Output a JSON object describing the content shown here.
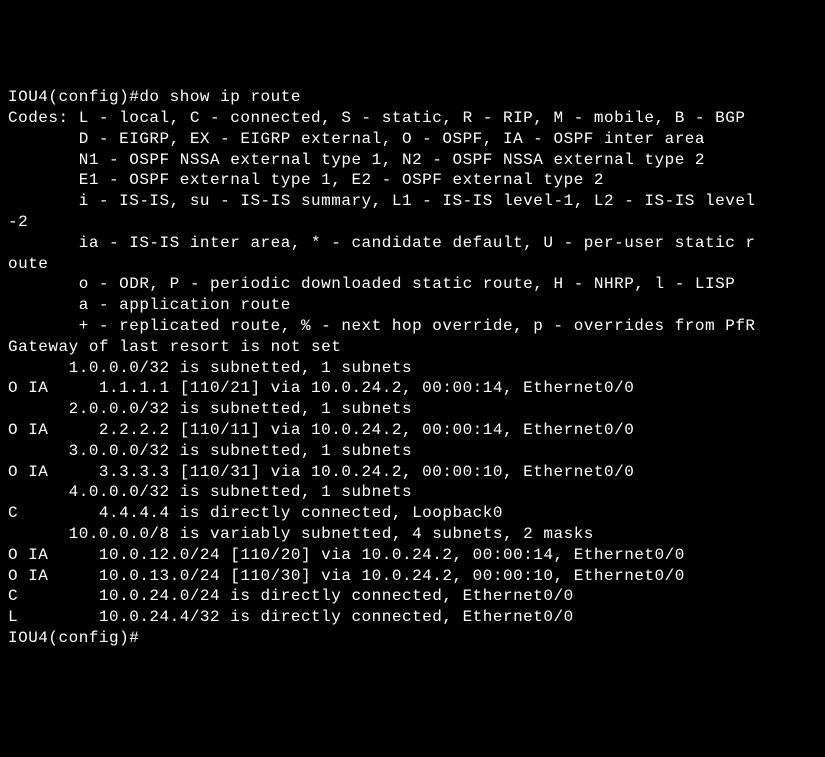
{
  "lines": [
    "IOU4(config)#do show ip route",
    "Codes: L - local, C - connected, S - static, R - RIP, M - mobile, B - BGP",
    "       D - EIGRP, EX - EIGRP external, O - OSPF, IA - OSPF inter area",
    "       N1 - OSPF NSSA external type 1, N2 - OSPF NSSA external type 2",
    "       E1 - OSPF external type 1, E2 - OSPF external type 2",
    "       i - IS-IS, su - IS-IS summary, L1 - IS-IS level-1, L2 - IS-IS level",
    "-2",
    "       ia - IS-IS inter area, * - candidate default, U - per-user static r",
    "oute",
    "       o - ODR, P - periodic downloaded static route, H - NHRP, l - LISP",
    "       a - application route",
    "       + - replicated route, % - next hop override, p - overrides from PfR",
    "",
    "Gateway of last resort is not set",
    "",
    "      1.0.0.0/32 is subnetted, 1 subnets",
    "O IA     1.1.1.1 [110/21] via 10.0.24.2, 00:00:14, Ethernet0/0",
    "      2.0.0.0/32 is subnetted, 1 subnets",
    "O IA     2.2.2.2 [110/11] via 10.0.24.2, 00:00:14, Ethernet0/0",
    "      3.0.0.0/32 is subnetted, 1 subnets",
    "O IA     3.3.3.3 [110/31] via 10.0.24.2, 00:00:10, Ethernet0/0",
    "      4.0.0.0/32 is subnetted, 1 subnets",
    "C        4.4.4.4 is directly connected, Loopback0",
    "      10.0.0.0/8 is variably subnetted, 4 subnets, 2 masks",
    "O IA     10.0.12.0/24 [110/20] via 10.0.24.2, 00:00:14, Ethernet0/0",
    "O IA     10.0.13.0/24 [110/30] via 10.0.24.2, 00:00:10, Ethernet0/0",
    "C        10.0.24.0/24 is directly connected, Ethernet0/0",
    "L        10.0.24.4/32 is directly connected, Ethernet0/0",
    "IOU4(config)#"
  ]
}
